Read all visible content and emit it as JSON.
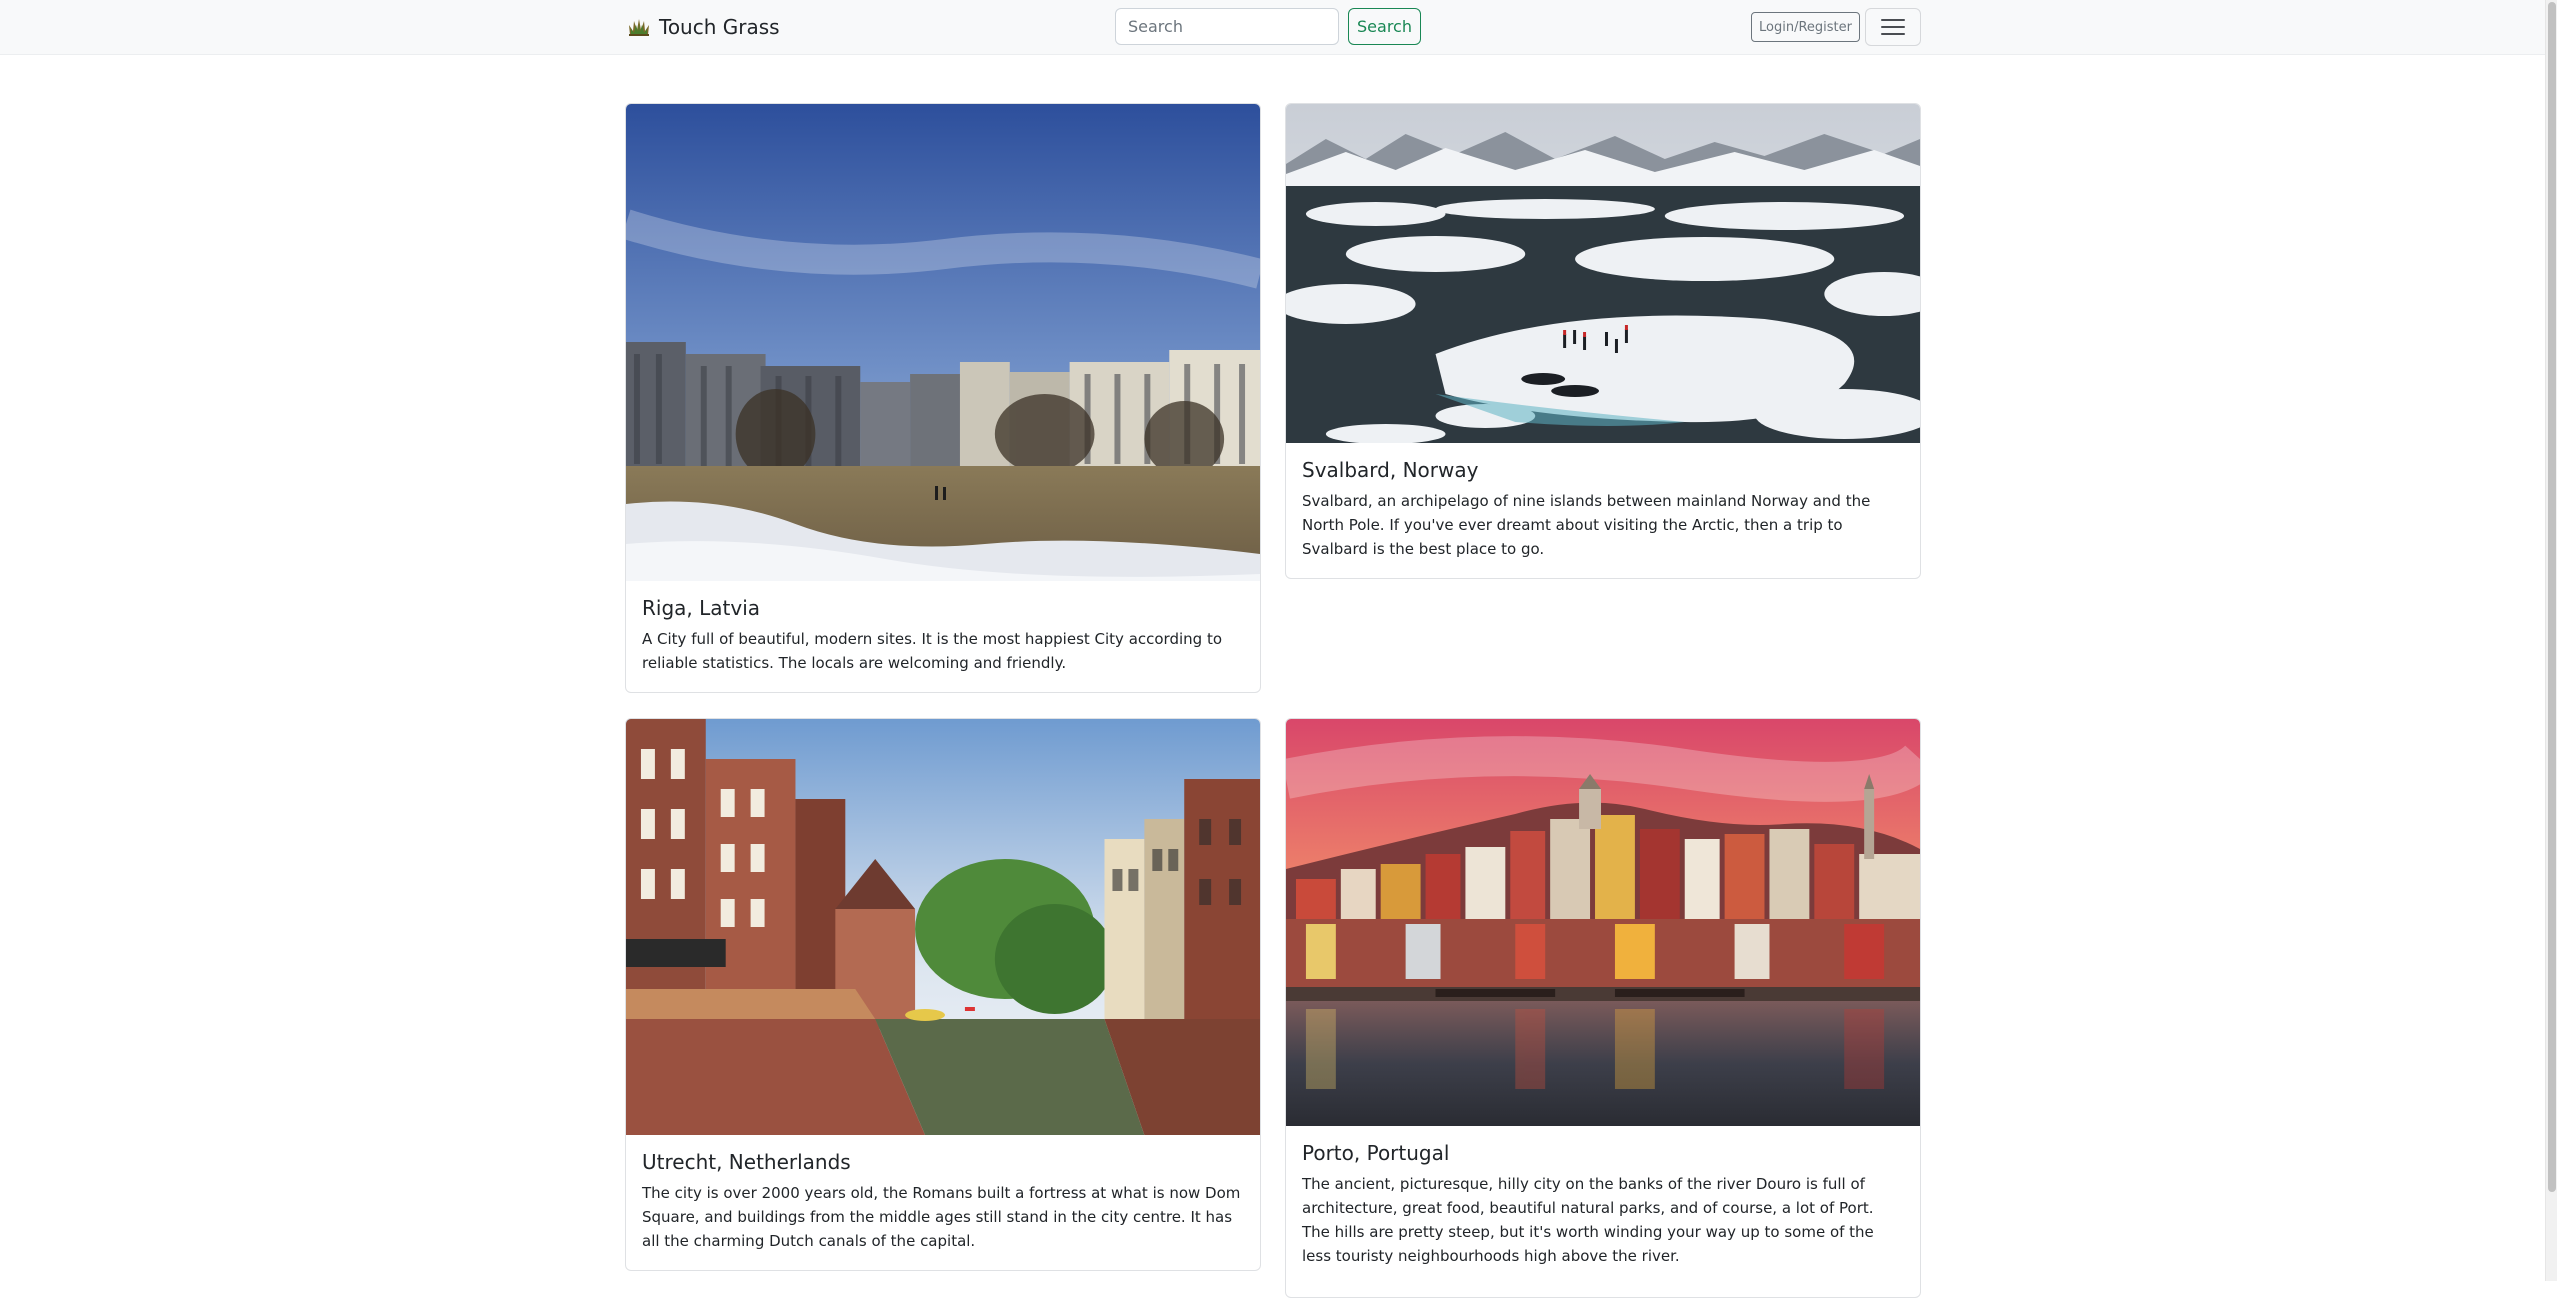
{
  "navbar": {
    "brand": "Touch Grass",
    "brand_icon": "grass-icon",
    "search": {
      "placeholder": "Search",
      "value": "",
      "button_label": "Search"
    },
    "login_label": "Login/Register",
    "menu_icon": "hamburger-icon"
  },
  "colors": {
    "navbar_bg": "#f8f9fa",
    "success": "#198754",
    "secondary": "#6c757d"
  },
  "cards": [
    {
      "title": "Riga, Latvia",
      "text": "A City full of beautiful, modern sites. It is the most happiest City according to reliable statistics. The locals are welcoming and friendly."
    },
    {
      "title": "Svalbard, Norway",
      "text": "Svalbard, an archipelago of nine islands between mainland Norway and the North Pole. If you've ever dreamt about visiting the Arctic, then a trip to Svalbard is the best place to go."
    },
    {
      "title": "Utrecht, Netherlands",
      "text": "The city is over 2000 years old, the Romans built a fortress at what is now Dom Square, and buildings from the middle ages still stand in the city centre. It has all the charming Dutch canals of the capital."
    },
    {
      "title": "Porto, Portugal",
      "text": "The ancient, picturesque, hilly city on the banks of the river Douro is full of architecture, great food, beautiful natural parks, and of course, a lot of Port. The hills are pretty steep, but it's worth winding your way up to some of the less touristy neighbourhoods high above the river."
    }
  ]
}
